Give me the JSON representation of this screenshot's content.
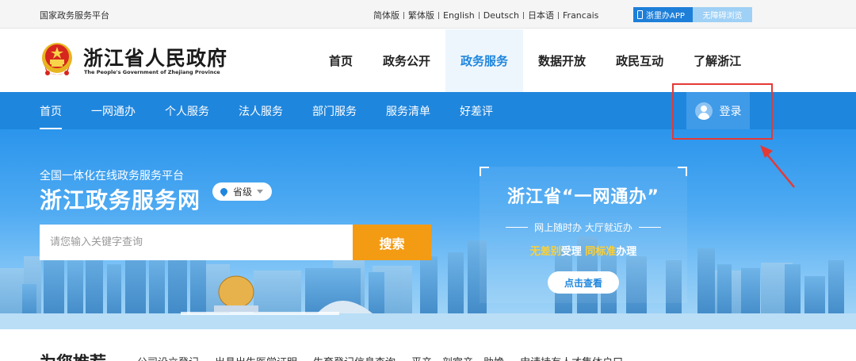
{
  "topbar": {
    "site_name": "国家政务服务平台",
    "languages": [
      "简体版",
      "繁体版",
      "English",
      "Deutsch",
      "日本语",
      "Francais"
    ],
    "app_label": "浙里办APP",
    "accessibility_label": "无障碍浏览"
  },
  "header": {
    "logo_title": "浙江省人民政府",
    "logo_subtitle": "The People's Government of Zhejiang Province",
    "nav": [
      "首页",
      "政务公开",
      "政务服务",
      "数据开放",
      "政民互动",
      "了解浙江"
    ],
    "active_nav": "政务服务"
  },
  "subnav": {
    "items": [
      "首页",
      "一网通办",
      "个人服务",
      "法人服务",
      "部门服务",
      "服务清单",
      "好差评"
    ],
    "login_label": "登录"
  },
  "banner": {
    "slogan": "全国一体化在线政务服务平台",
    "portal_title": "浙江政务服务网",
    "level_selector": "省级",
    "search_placeholder": "请您输入关键字查询",
    "search_button": "搜索",
    "promo": {
      "title": "浙江省“一网通办”",
      "subtitle": "网上随时办  大厅就近办",
      "tag_part1": "无差别",
      "tag_part2": "受理 ",
      "tag_part3": "同标准",
      "tag_part4": "办理",
      "button": "点击查看"
    }
  },
  "recommend": {
    "title": "为您推荐",
    "links": [
      "公司设立登记",
      "出具出生医学证明",
      "生育登记信息查询",
      "平产、剖宫产、助娩",
      "申请持有人才集体户口"
    ]
  },
  "colors": {
    "brand_blue": "#1f86dd",
    "search_orange": "#f49b14",
    "annotation_red": "#e53935"
  }
}
